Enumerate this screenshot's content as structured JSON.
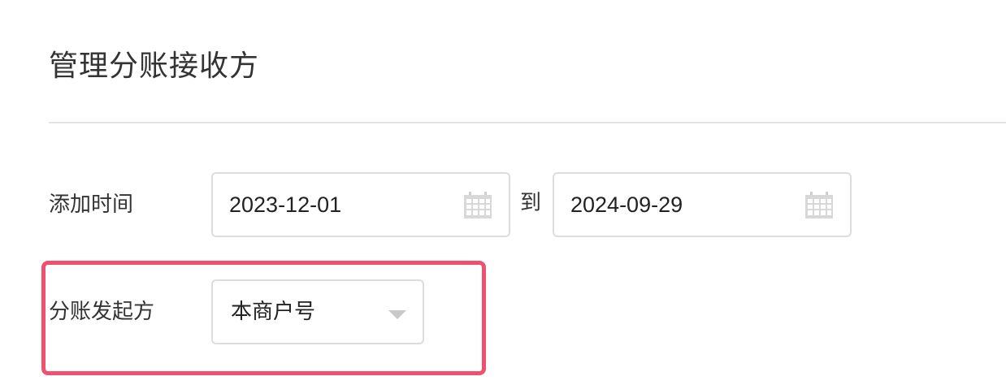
{
  "page": {
    "title": "管理分账接收方"
  },
  "filters": {
    "add_time": {
      "label": "添加时间",
      "start_date": "2023-12-01",
      "separator": "到",
      "end_date": "2024-09-29",
      "icon": "calendar-icon"
    },
    "initiator": {
      "label": "分账发起方",
      "selected": "本商户号",
      "icon": "chevron-down-icon"
    }
  },
  "annotation": {
    "highlight_color": "#f0506e"
  }
}
